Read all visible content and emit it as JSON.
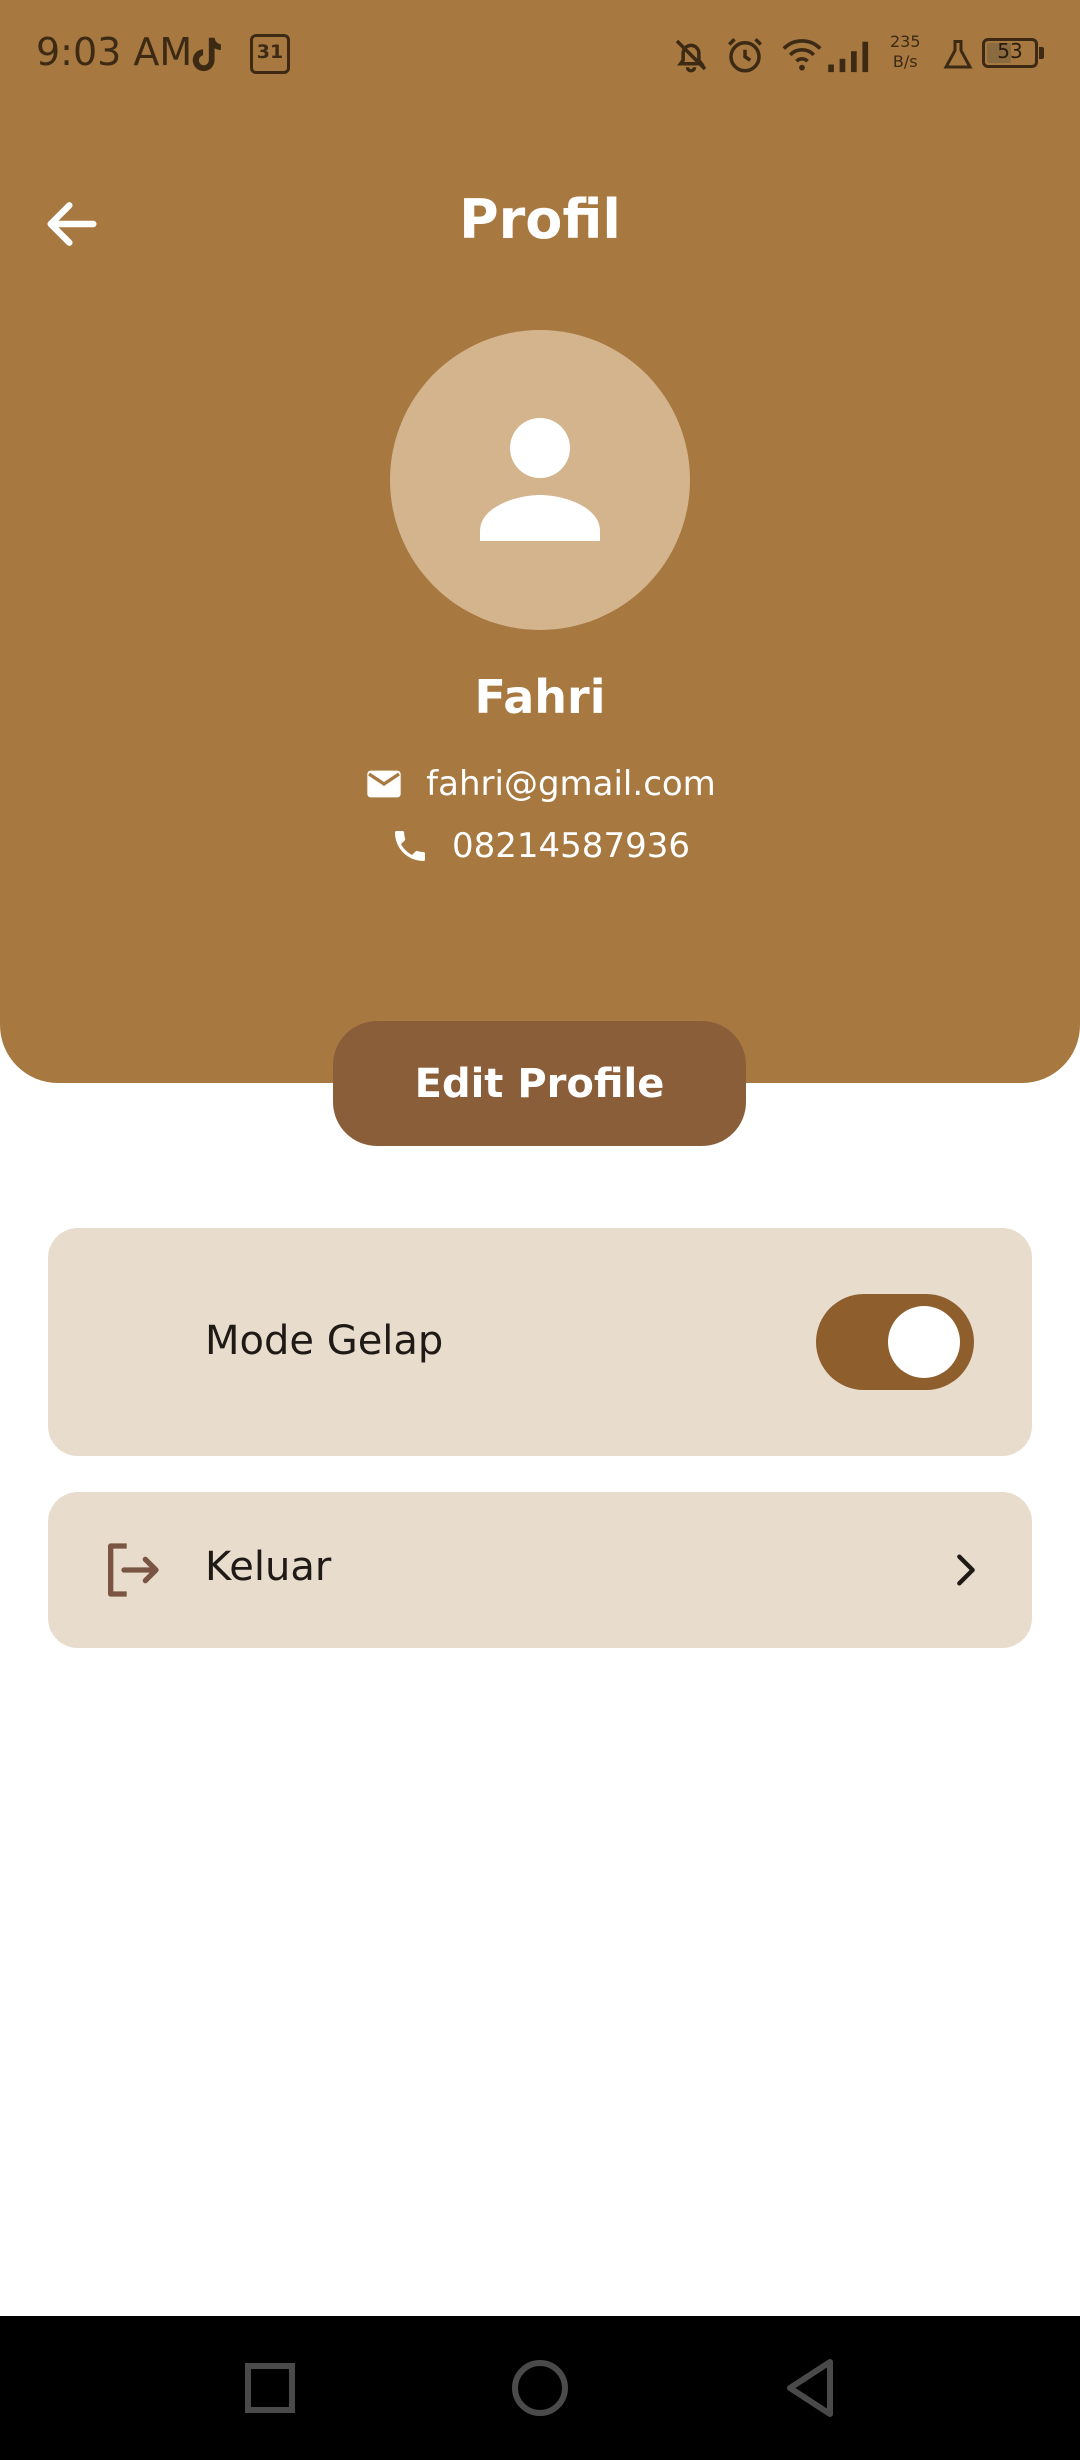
{
  "status_bar": {
    "time": "9:03 AM",
    "calendar_day": "31",
    "net_speed_value": "235",
    "net_speed_unit": "B/s",
    "battery": "53",
    "battery_level_pct": 53,
    "icons": [
      "tiktok-icon",
      "calendar-icon",
      "bell-off-icon",
      "alarm-icon",
      "wifi-icon",
      "signal-icon",
      "flask-icon",
      "battery-icon"
    ]
  },
  "header": {
    "title": "Profil",
    "back_icon": "arrow-left-icon"
  },
  "profile": {
    "avatar_icon": "person-icon",
    "name": "Fahri",
    "email": "fahri@gmail.com",
    "phone": "08214587936",
    "email_icon": "mail-icon",
    "phone_icon": "phone-icon",
    "edit_label": "Edit Profile"
  },
  "settings": {
    "dark_mode": {
      "label": "Mode Gelap",
      "icon": "moon-icon",
      "enabled": true
    },
    "logout": {
      "label": "Keluar",
      "icon": "logout-icon",
      "chevron": "chevron-right-icon"
    }
  },
  "nav": {
    "recents": "square-icon",
    "home": "circle-icon",
    "back": "triangle-back-icon"
  },
  "colors": {
    "header_bg": "#A77941",
    "avatar_bg": "#D4B48D",
    "edit_button": "#8B5E3A",
    "card_bg": "#E8DCCC",
    "toggle_on": "#8E5F2D",
    "icon_brown": "#7A5543"
  }
}
